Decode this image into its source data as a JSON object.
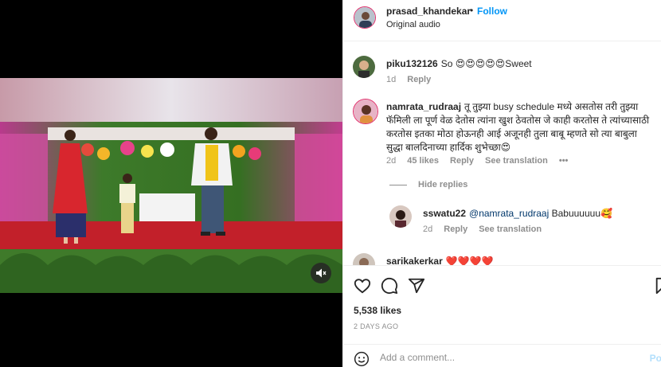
{
  "post": {
    "author": "prasad_khandekar",
    "dot": "•",
    "follow_label": "Follow",
    "audio": "Original audio"
  },
  "comments": [
    {
      "user": "piku132126",
      "text": "So 😍😍😍😍😍Sweet",
      "time": "1d",
      "reply": "Reply"
    },
    {
      "user": "namrata_rudraaj",
      "text": "तू तुझ्या busy schedule मध्ये असतोस तरी तुझ्या फॅमिली ला पूर्ण वेळ देतोस त्यांना खुश ठेवतोस जे काही करतोस ते त्यांच्यासाठी करतोस इतका मोठा होऊनही आई अजूनही तुला बाबू म्हणते सो त्या बाबुला सुद्धा बालदिनाच्या हार्दिक शुभेच्छा😍",
      "time": "2d",
      "likes": "45 likes",
      "reply": "Reply",
      "see_translation": "See translation",
      "more": "•••"
    },
    {
      "user": "sarikakerkar",
      "text": "❤️❤️❤️❤️"
    }
  ],
  "hide_replies": "Hide replies",
  "reply": {
    "user": "sswatu22",
    "mention": "@namrata_rudraaj",
    "text": " Babuuuuuu🥰",
    "time": "2d",
    "reply": "Reply",
    "see_translation": "See translation"
  },
  "stats": {
    "likes": "5,538 likes",
    "date": "2 DAYS AGO"
  },
  "composer": {
    "placeholder": "Add a comment...",
    "post_label": "Po"
  },
  "icons": {
    "like": "heart-icon",
    "comment": "comment-icon",
    "share": "share-icon",
    "save": "bookmark-icon",
    "emoji": "emoji-icon",
    "mute": "speaker-muted-icon"
  },
  "colors": {
    "follow": "#0095f6",
    "post_disabled": "#b2dffc",
    "secondary_text": "#8e8e8e"
  }
}
